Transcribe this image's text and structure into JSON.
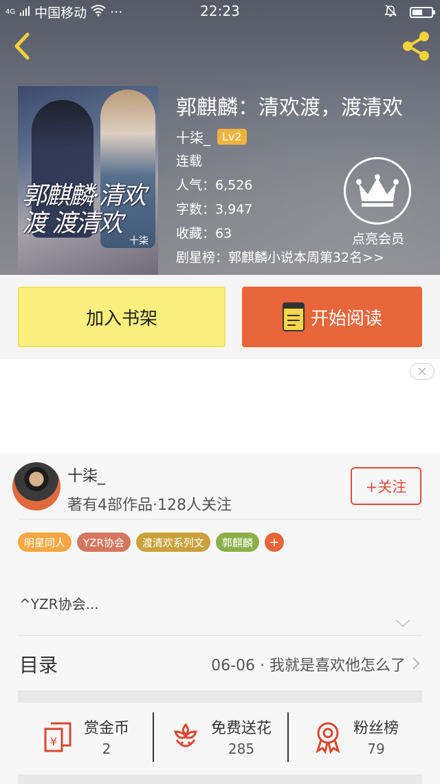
{
  "status_bar": {
    "network": "4G",
    "carrier": "中国移动",
    "more": "···",
    "time": "22:23"
  },
  "book": {
    "title": "郭麒麟：清欢渡，渡清欢",
    "cover_title_art": "郭麒麟·清欢渡 渡清欢",
    "cover_author_art": "十柒",
    "author": "十柒_",
    "level": "Lv2",
    "status": "连载",
    "popularity": "人气：6,526",
    "word_count": "字数：3,947",
    "favorites": "收藏：63",
    "ranking": "剧星榜：郭麒麟小说本周第32名>>"
  },
  "vip": {
    "label": "点亮会员",
    "icon": "crown-icon"
  },
  "actions": {
    "add_to_shelf": "加入书架",
    "start_reading": "开始阅读"
  },
  "author_card": {
    "name": "十柒_",
    "meta": "著有4部作品·128人关注",
    "follow": "+关注"
  },
  "tags": [
    {
      "label": "明星同人",
      "color": "#f4a742"
    },
    {
      "label": "YZR协会",
      "color": "#d4775f"
    },
    {
      "label": "渡清欢系列文",
      "color": "#c9a13a"
    },
    {
      "label": "郭麒麟",
      "color": "#8bb04a"
    }
  ],
  "tag_add": "+",
  "intro": "^YZR协会...",
  "toc": {
    "label": "目录",
    "latest": "06-06 · 我就是喜欢他怎么了"
  },
  "stats": [
    {
      "label": "赏金币",
      "value": "2",
      "icon": "reward-coin-icon"
    },
    {
      "label": "免费送花",
      "value": "285",
      "icon": "flower-icon"
    },
    {
      "label": "粉丝榜",
      "value": "79",
      "icon": "medal-icon"
    }
  ],
  "colors": {
    "accent_orange": "#e8663a",
    "shelf_yellow": "#fbef7e",
    "follow_red": "#e04a3a",
    "level_badge": "#f0b33d",
    "icon_red": "#d9472f"
  }
}
